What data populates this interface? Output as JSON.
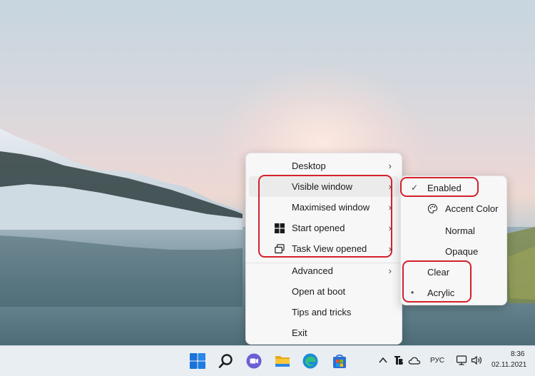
{
  "menu": {
    "items": [
      {
        "label": "Desktop",
        "icon": "",
        "submenu": true
      },
      {
        "label": "Visible window",
        "icon": "",
        "submenu": true
      },
      {
        "label": "Maximised window",
        "icon": "",
        "submenu": true
      },
      {
        "label": "Start opened",
        "icon": "windows-logo-icon",
        "submenu": true
      },
      {
        "label": "Task View opened",
        "icon": "task-view-icon",
        "submenu": true
      },
      {
        "label": "Advanced",
        "icon": "",
        "submenu": true
      },
      {
        "label": "Open at boot",
        "icon": "",
        "submenu": false
      },
      {
        "label": "Tips and tricks",
        "icon": "",
        "submenu": false
      },
      {
        "label": "Exit",
        "icon": "",
        "submenu": false
      }
    ]
  },
  "submenu": {
    "items": [
      {
        "label": "Enabled",
        "mark": "✓"
      },
      {
        "label": "Accent Color",
        "icon": "palette-icon"
      },
      {
        "label": "Normal"
      },
      {
        "label": "Opaque"
      },
      {
        "label": "Clear"
      },
      {
        "label": "Acrylic",
        "mark": "•"
      }
    ]
  },
  "taskbar": {
    "apps": [
      "windows-start-icon",
      "search-icon",
      "chat-icon",
      "file-explorer-icon",
      "edge-icon",
      "store-icon"
    ],
    "tray": {
      "lang": "РУС",
      "time": "8:36",
      "date": "02.11.2021"
    }
  },
  "colors": {
    "highlight": "#d4202a",
    "accent": "#0067c0"
  }
}
